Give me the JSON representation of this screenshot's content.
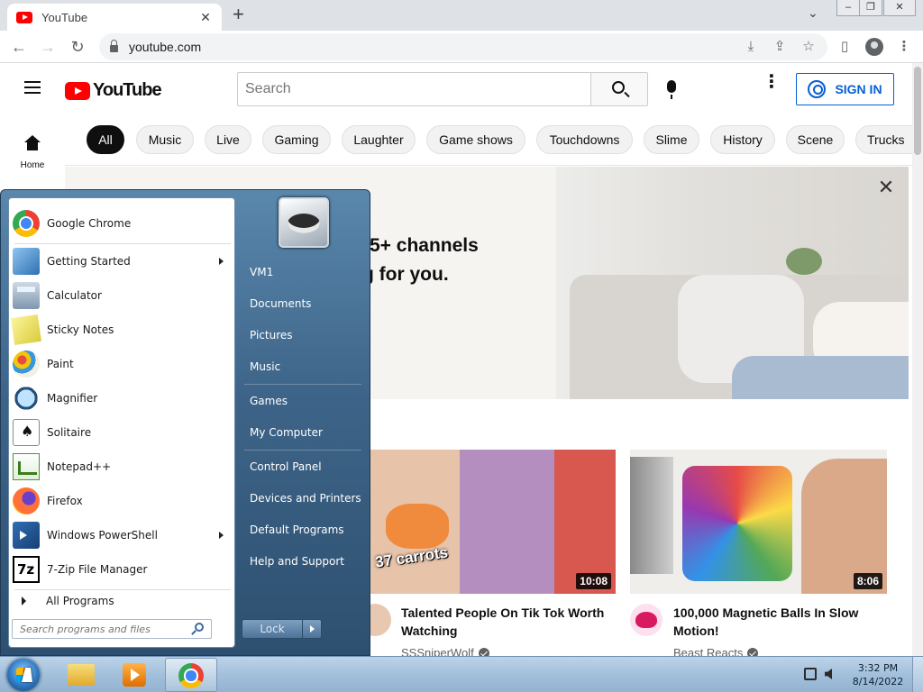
{
  "browser": {
    "tab_title": "YouTube",
    "tab_close": "✕",
    "new_tab": "+",
    "tab_search": "⌄",
    "window_controls": {
      "minimize": "–",
      "restore": "❐",
      "close": "✕"
    },
    "nav": {
      "back": "←",
      "forward": "→",
      "reload": "↻"
    },
    "url": "youtube.com",
    "toolbar_icons": {
      "install": "⤓",
      "share": "⇪",
      "bookmark": "☆",
      "sidepanel": "▯",
      "menu": "⋮"
    }
  },
  "youtube": {
    "logo_text": "YouTube",
    "search_placeholder": "Search",
    "more_icon": "⋮",
    "sign_in": "SIGN IN",
    "guide_home": "Home",
    "chips": [
      "All",
      "Music",
      "Live",
      "Gaming",
      "Laughter",
      "Game shows",
      "Touchdowns",
      "Slime",
      "History",
      "Scene",
      "Trucks"
    ],
    "banner": {
      "line1": "5+ channels",
      "line2": "g for you.",
      "close": "✕"
    },
    "videos": [
      {
        "thumb_caption": "37 carrots",
        "duration": "10:08",
        "title": "Talented People On Tik Tok Worth Watching",
        "channel": "SSSniperWolf"
      },
      {
        "thumb_caption": "",
        "duration": "8:06",
        "title": "100,000 Magnetic Balls In Slow Motion!",
        "channel": "Beast Reacts"
      }
    ]
  },
  "start_menu": {
    "programs": [
      {
        "label": "Google Chrome",
        "icon": "chrome-icon",
        "submenu": false
      },
      {
        "label": "Getting Started",
        "icon": "getting-started-icon",
        "submenu": true
      },
      {
        "label": "Calculator",
        "icon": "calculator-icon",
        "submenu": false
      },
      {
        "label": "Sticky Notes",
        "icon": "sticky-notes-icon",
        "submenu": false
      },
      {
        "label": "Paint",
        "icon": "paint-icon",
        "submenu": false
      },
      {
        "label": "Magnifier",
        "icon": "magnifier-icon",
        "submenu": false
      },
      {
        "label": "Solitaire",
        "icon": "solitaire-icon",
        "submenu": false
      },
      {
        "label": "Notepad++",
        "icon": "notepad-plus-plus-icon",
        "submenu": false
      },
      {
        "label": "Firefox",
        "icon": "firefox-icon",
        "submenu": false
      },
      {
        "label": "Windows PowerShell",
        "icon": "powershell-icon",
        "submenu": true
      },
      {
        "label": "7-Zip File Manager",
        "icon": "7zip-icon",
        "submenu": false
      }
    ],
    "all_programs": "All Programs",
    "search_placeholder": "Search programs and files",
    "right_items": [
      "VM1",
      "Documents",
      "Pictures",
      "Music",
      "Games",
      "My Computer",
      "Control Panel",
      "Devices and Printers",
      "Default Programs",
      "Help and Support"
    ],
    "lock_button": "Lock"
  },
  "taskbar": {
    "time": "3:32 PM",
    "date": "8/14/2022"
  }
}
